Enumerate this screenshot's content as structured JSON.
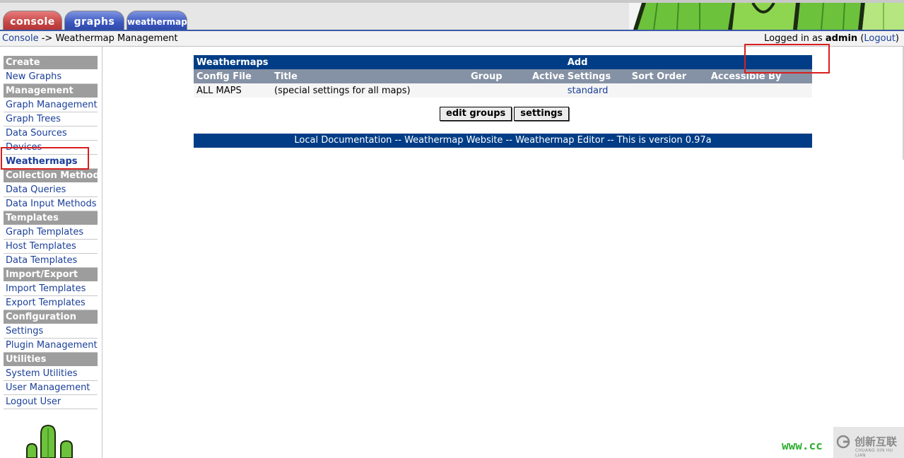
{
  "tabs": [
    {
      "label": "console"
    },
    {
      "label": "graphs"
    },
    {
      "label": "weathermap"
    }
  ],
  "breadcrumb": {
    "home": "Console",
    "separator": " -> ",
    "current": "Weathermap Management"
  },
  "login": {
    "prefix": "Logged in as ",
    "user": "admin",
    "open_paren": " (",
    "logout": "Logout",
    "close_paren": ")"
  },
  "sidebar": {
    "sections": [
      {
        "title": "Create",
        "items": [
          "New Graphs"
        ]
      },
      {
        "title": "Management",
        "items": [
          "Graph Management",
          "Graph Trees",
          "Data Sources",
          "Devices",
          "Weathermaps"
        ]
      },
      {
        "title": "Collection Methods",
        "items": [
          "Data Queries",
          "Data Input Methods"
        ]
      },
      {
        "title": "Templates",
        "items": [
          "Graph Templates",
          "Host Templates",
          "Data Templates"
        ]
      },
      {
        "title": "Import/Export",
        "items": [
          "Import Templates",
          "Export Templates"
        ]
      },
      {
        "title": "Configuration",
        "items": [
          "Settings",
          "Plugin Management"
        ]
      },
      {
        "title": "Utilities",
        "items": [
          "System Utilities",
          "User Management",
          "Logout User"
        ]
      }
    ],
    "active_item": "Weathermaps"
  },
  "maps_table": {
    "title": "Weathermaps",
    "add_label": "Add",
    "columns": [
      "Config File",
      "Title",
      "Group",
      "Active",
      "Settings",
      "Sort Order",
      "Accessible By"
    ],
    "rows": [
      {
        "config_file": "ALL MAPS",
        "title": "(special settings for all maps)",
        "group": "",
        "active": "",
        "settings": "standard",
        "sort_order": "",
        "accessible_by": ""
      }
    ]
  },
  "buttons": {
    "edit_groups": "edit groups",
    "settings": "settings"
  },
  "footer": {
    "local_docs": "Local Documentation",
    "sep": " -- ",
    "website": "Weathermap Website",
    "editor": "Weathermap Editor",
    "version": "This is version 0.97a"
  },
  "watermark": {
    "url_fragment": "www.cc",
    "brand": "创新互联",
    "brand_small": "CHUANG XIN HU LIAN"
  },
  "colors": {
    "header_blue": "#003d86",
    "column_header": "#8591a4",
    "sidebar_header": "#9d9d9d",
    "link": "#1a3f99",
    "annotation": "#d81f1f"
  }
}
